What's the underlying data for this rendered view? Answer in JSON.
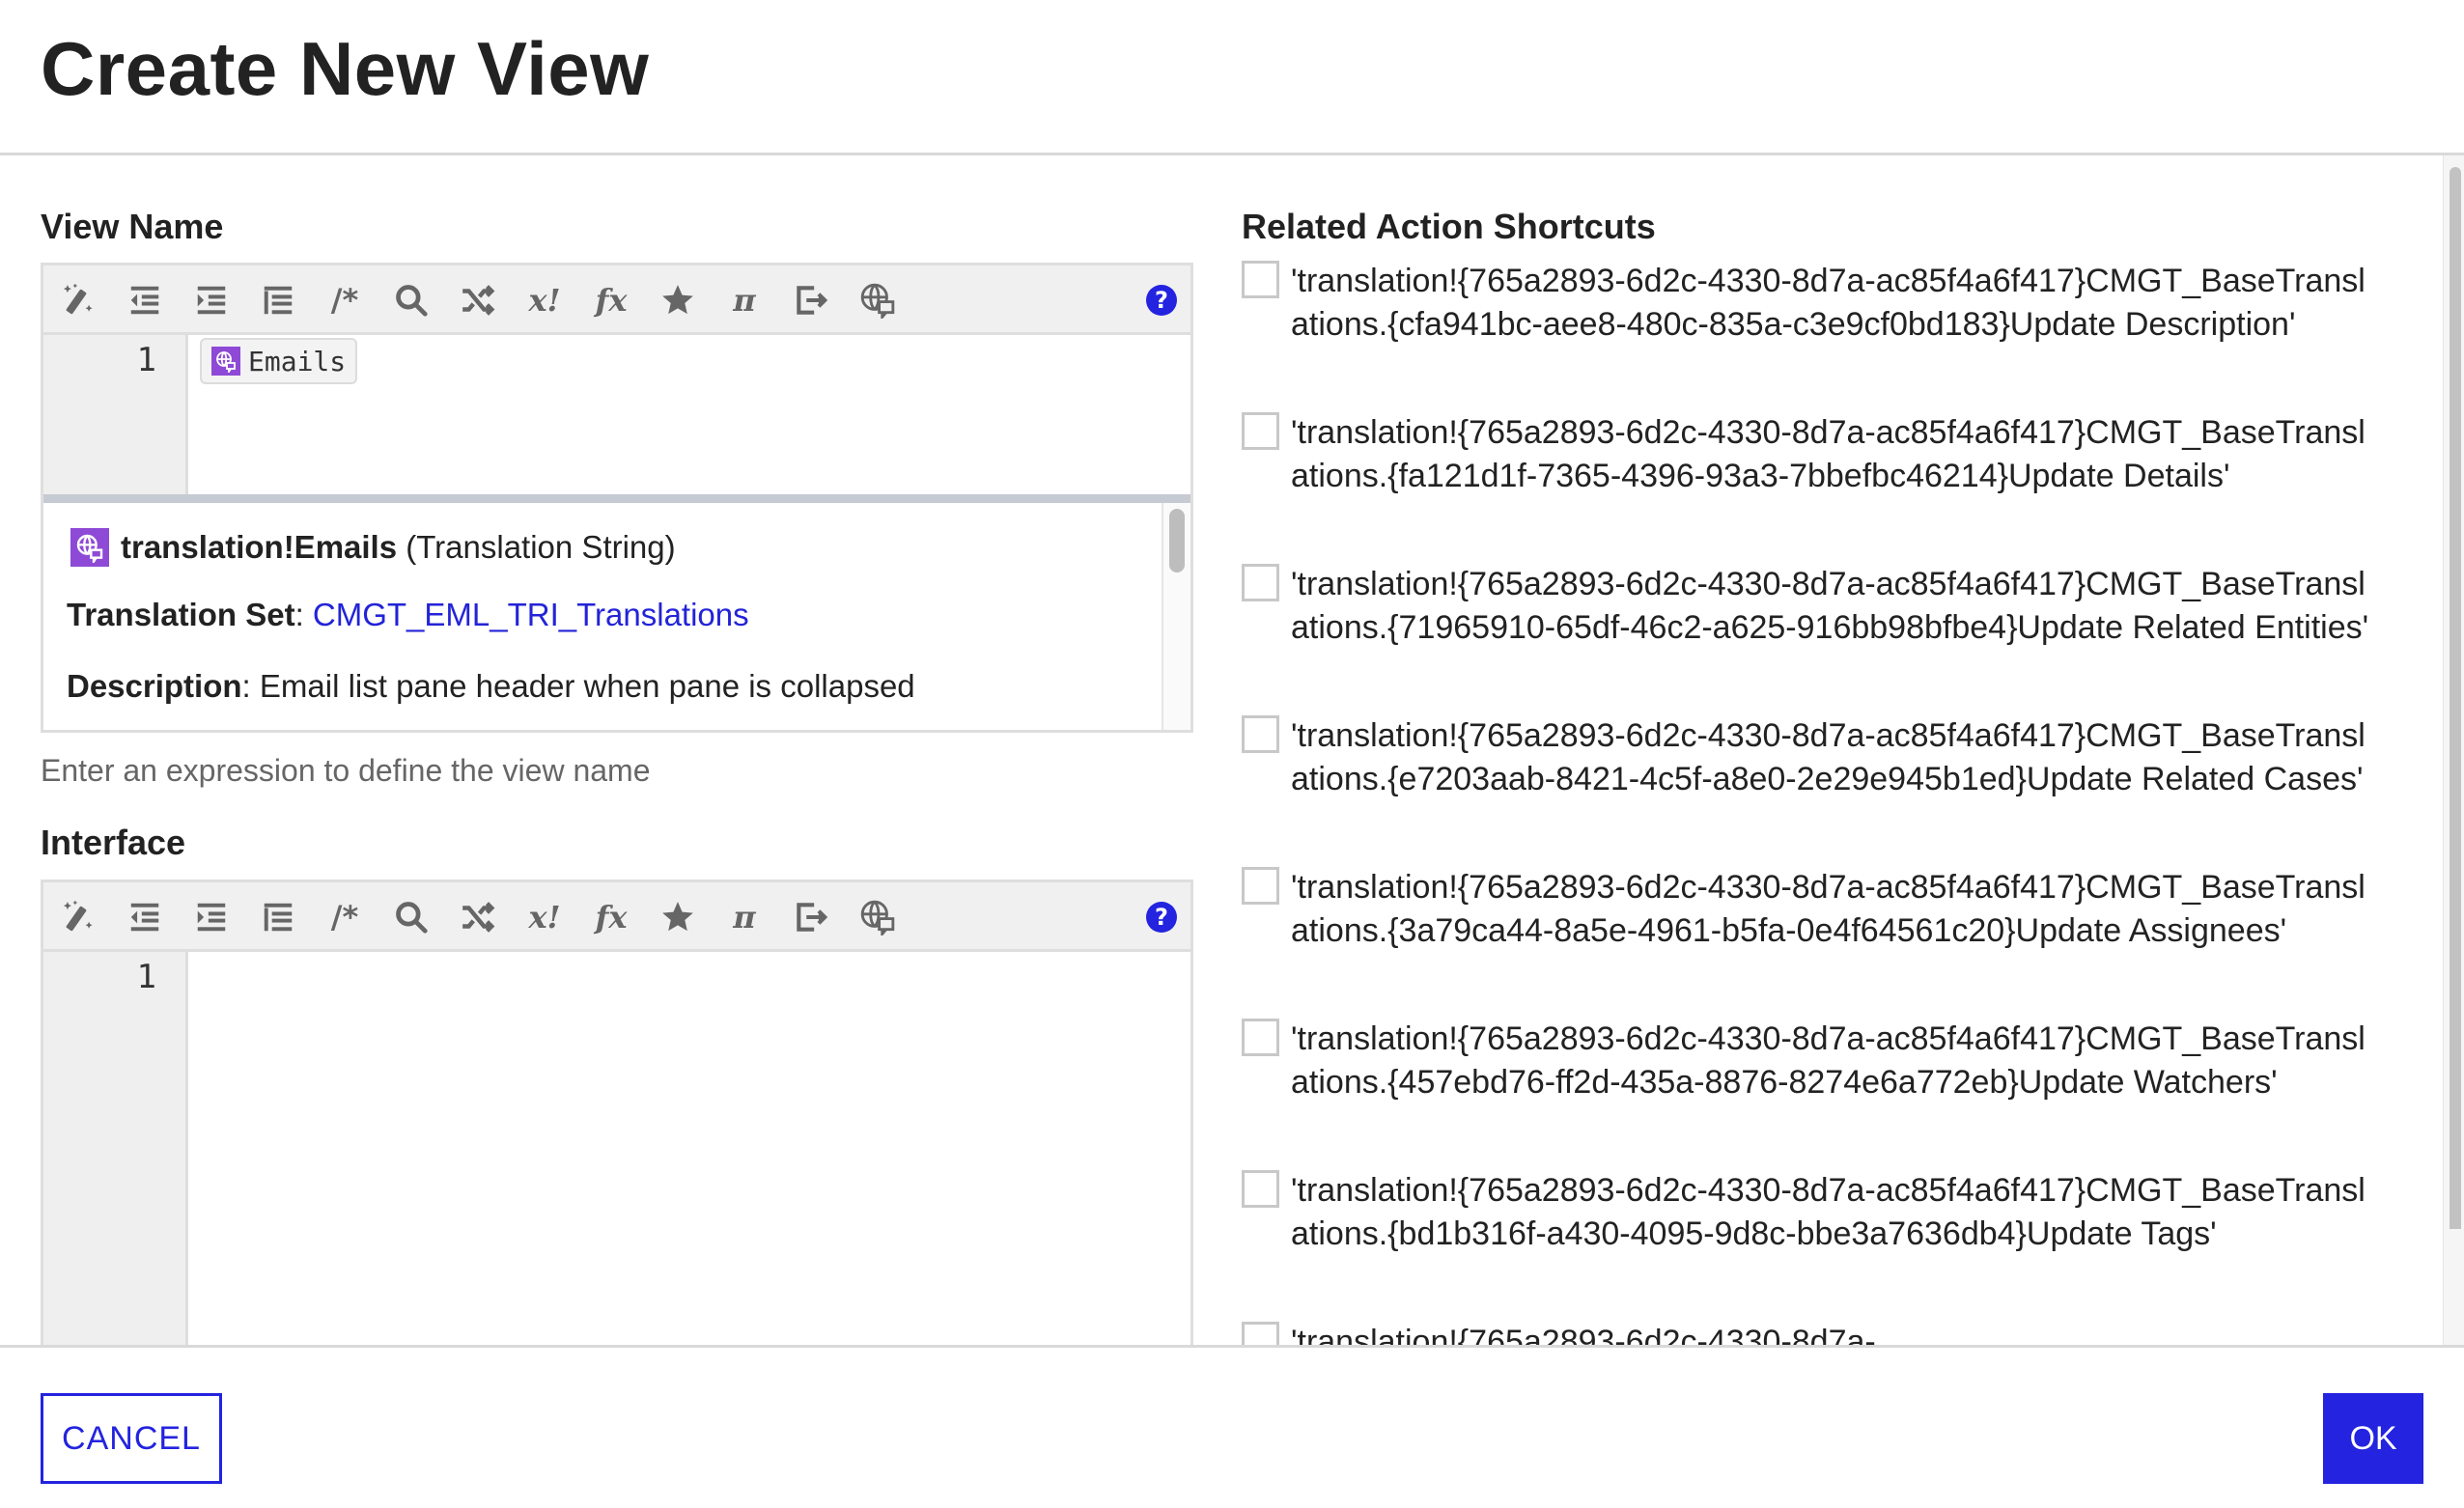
{
  "dialog": {
    "title": "Create New View"
  },
  "view_name": {
    "label": "View Name",
    "line_number": "1",
    "chip": {
      "icon": "translation-icon",
      "text": "Emails"
    },
    "detail": {
      "name": "translation!Emails",
      "type": "(Translation String)",
      "translation_set_label": "Translation Set",
      "translation_set_value": "CMGT_EML_TRI_Translations",
      "description_label": "Description",
      "description_value": "Email list pane header when pane is collapsed"
    },
    "hint": "Enter an expression to define the view name"
  },
  "interface": {
    "label": "Interface",
    "line_number": "1",
    "value": ""
  },
  "toolbar": {
    "buttons": [
      {
        "name": "format-expression",
        "icon": "magic-wand-icon"
      },
      {
        "name": "decrease-indent",
        "icon": "outdent-icon"
      },
      {
        "name": "increase-indent",
        "icon": "indent-icon"
      },
      {
        "name": "auto-indent",
        "icon": "list-indent-icon"
      },
      {
        "name": "toggle-comment",
        "icon": "comment-icon",
        "text": "/*"
      },
      {
        "name": "find",
        "icon": "search-icon"
      },
      {
        "name": "replace",
        "icon": "shuffle-icon"
      },
      {
        "name": "test-expression",
        "icon": "test-icon",
        "text": "x!"
      },
      {
        "name": "expression-functions",
        "icon": "function-icon",
        "text": "fx"
      },
      {
        "name": "favorites",
        "icon": "star-icon"
      },
      {
        "name": "constants",
        "icon": "pi-icon",
        "text": "π"
      },
      {
        "name": "extract",
        "icon": "export-icon"
      },
      {
        "name": "translations",
        "icon": "translation-icon"
      }
    ],
    "help": "?"
  },
  "related_action_shortcuts": {
    "label": "Related Action Shortcuts",
    "items": [
      {
        "checked": false,
        "text": "'translation!{765a2893-6d2c-4330-8d7a-ac85f4a6f417}CMGT_BaseTranslations.{cfa941bc-aee8-480c-835a-c3e9cf0bd183}Update Description'"
      },
      {
        "checked": false,
        "text": "'translation!{765a2893-6d2c-4330-8d7a-ac85f4a6f417}CMGT_BaseTranslations.{fa121d1f-7365-4396-93a3-7bbefbc46214}Update Details'"
      },
      {
        "checked": false,
        "text": "'translation!{765a2893-6d2c-4330-8d7a-ac85f4a6f417}CMGT_BaseTranslations.{71965910-65df-46c2-a625-916bb98bfbe4}Update Related Entities'"
      },
      {
        "checked": false,
        "text": "'translation!{765a2893-6d2c-4330-8d7a-ac85f4a6f417}CMGT_BaseTranslations.{e7203aab-8421-4c5f-a8e0-2e29e945b1ed}Update Related Cases'"
      },
      {
        "checked": false,
        "text": "'translation!{765a2893-6d2c-4330-8d7a-ac85f4a6f417}CMGT_BaseTranslations.{3a79ca44-8a5e-4961-b5fa-0e4f64561c20}Update Assignees'"
      },
      {
        "checked": false,
        "text": "'translation!{765a2893-6d2c-4330-8d7a-ac85f4a6f417}CMGT_BaseTranslations.{457ebd76-ff2d-435a-8876-8274e6a772eb}Update Watchers'"
      },
      {
        "checked": false,
        "text": "'translation!{765a2893-6d2c-4330-8d7a-ac85f4a6f417}CMGT_BaseTranslations.{bd1b316f-a430-4095-9d8c-bbe3a7636db4}Update Tags'"
      },
      {
        "checked": false,
        "text": "'translation!{765a2893-6d2c-4330-8d7a-"
      }
    ]
  },
  "footer": {
    "cancel_label": "CANCEL",
    "ok_label": "OK"
  },
  "colors": {
    "accent": "#2323e0",
    "translation_badge": "#8e4ad6",
    "link": "#2323d8"
  }
}
